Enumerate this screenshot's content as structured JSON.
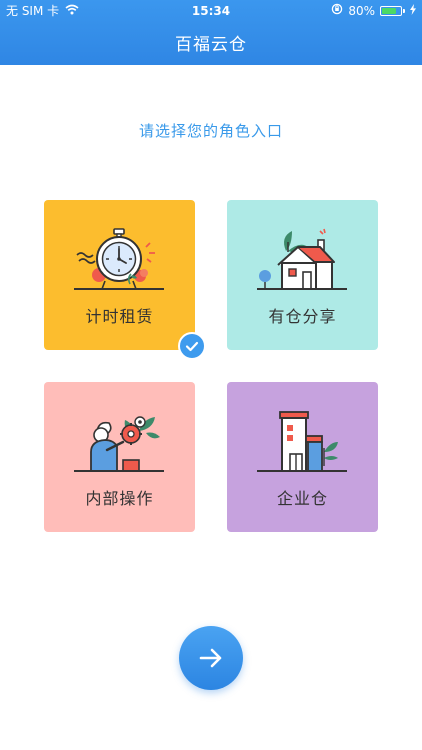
{
  "status_bar": {
    "carrier": "无 SIM 卡",
    "time": "15:34",
    "battery_percent": "80%",
    "battery_level": 0.8
  },
  "nav": {
    "title": "百福云仓"
  },
  "prompt": "请选择您的角色入口",
  "roles": [
    {
      "label": "计时租赁",
      "icon": "stopwatch-icon",
      "color": "#fcbd2e",
      "selected": true
    },
    {
      "label": "有仓分享",
      "icon": "house-icon",
      "color": "#aeeae6",
      "selected": false
    },
    {
      "label": "内部操作",
      "icon": "worker-gear-icon",
      "color": "#ffbdb9",
      "selected": false
    },
    {
      "label": "企业仓",
      "icon": "building-icon",
      "color": "#c6a2de",
      "selected": false
    }
  ],
  "next_button": {
    "icon": "arrow-right-icon"
  }
}
